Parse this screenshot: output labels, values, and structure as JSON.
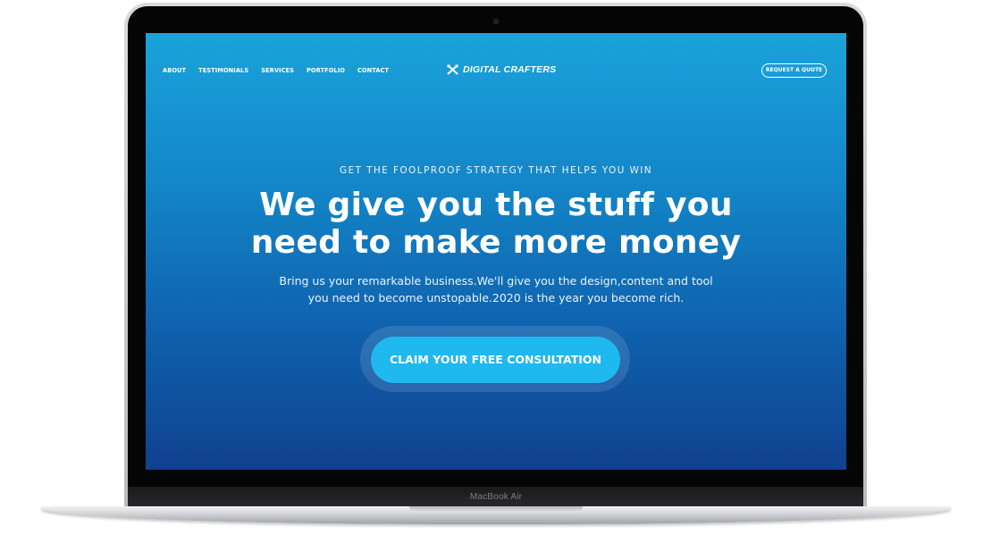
{
  "device": {
    "model_label": "MacBook Air"
  },
  "header": {
    "nav_items": [
      {
        "label": "ABOUT"
      },
      {
        "label": "TESTIMONIALS"
      },
      {
        "label": "SERVICES"
      },
      {
        "label": "PORTFOLIO"
      },
      {
        "label": "CONTACT"
      }
    ],
    "brand_name": "DIGITAL CRAFTERS",
    "brand_icon": "crossed-tools-icon",
    "cta_label": "REQUEST A QUOTE"
  },
  "hero": {
    "eyebrow": "GET THE FOOLPROOF STRATEGY THAT HELPS YOU WIN",
    "headline_line1": "We give you the stuff you",
    "headline_line2": "need to make more money",
    "subtext_line1": "Bring us your remarkable business.We'll give you the design,content and tool",
    "subtext_line2": "you need to become unstopable.2020 is the year you become rich.",
    "cta_label": "CLAIM YOUR FREE CONSULTATION"
  },
  "colors": {
    "screen_top": "#1aa3db",
    "screen_bottom": "#10418f",
    "cta_fill": "#1fb8ef",
    "text": "#ffffff"
  }
}
